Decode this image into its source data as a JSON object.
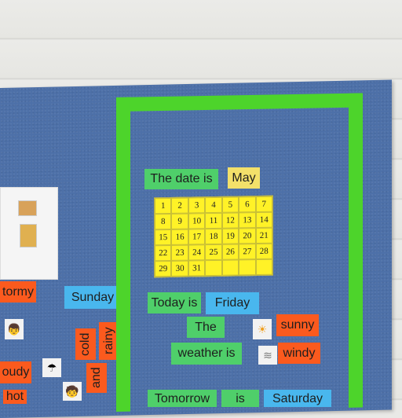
{
  "left_words": {
    "stormy": "tormy",
    "sunday": "Sunday",
    "cold": "cold",
    "rainy": "rainy",
    "cloudy": "oudy",
    "and": "and",
    "hot": "hot"
  },
  "date_section": {
    "label": "The date is",
    "month": "May",
    "calendar_days": [
      "1",
      "2",
      "3",
      "4",
      "5",
      "6",
      "7",
      "8",
      "9",
      "10",
      "11",
      "12",
      "13",
      "14",
      "15",
      "16",
      "17",
      "18",
      "19",
      "20",
      "21",
      "22",
      "23",
      "24",
      "25",
      "26",
      "27",
      "28",
      "29",
      "30",
      "31"
    ]
  },
  "today_section": {
    "label": "Today is",
    "day": "Friday"
  },
  "weather_section": {
    "label_the": "The",
    "label_weather": "weather is",
    "condition_1": "sunny",
    "condition_2": "windy"
  },
  "tomorrow_section": {
    "label": "Tomorrow",
    "is": "is",
    "day": "Saturday"
  },
  "icons": {
    "sun": "sun-icon",
    "wind": "wind-icon",
    "umbrella": "umbrella-icon",
    "person": "person-icon"
  },
  "colors": {
    "board": "#4d70a8",
    "frame": "#4dd42b",
    "green_card": "#4fcf6a",
    "blue_card": "#49b7ee",
    "orange_card": "#fb5a1e",
    "yellow_card": "#f3e06a",
    "calendar": "#fff227"
  }
}
